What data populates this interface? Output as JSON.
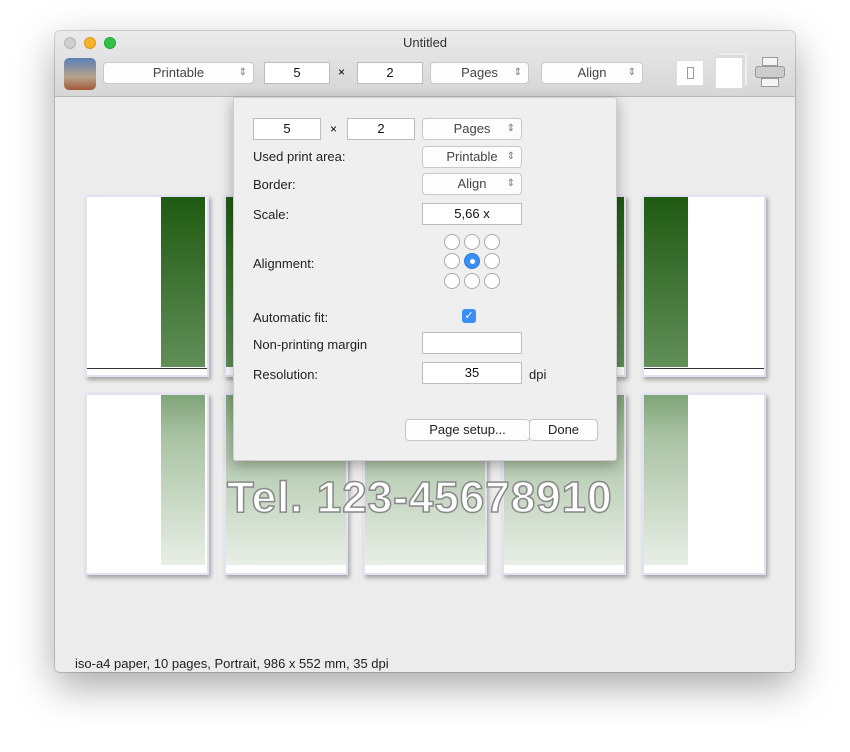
{
  "window": {
    "title": "Untitled"
  },
  "toolbar": {
    "area_select": "Printable",
    "cols": "5",
    "times": "×",
    "rows": "2",
    "unit_select": "Pages",
    "border_select": "Align"
  },
  "poster_text": "Tel. 123-45678910",
  "status": "iso-a4 paper, 10 pages, Portrait, 986 x 552 mm, 35 dpi",
  "panel": {
    "cols": "5",
    "times": "×",
    "rows": "2",
    "unit_select": "Pages",
    "used_print_area_label": "Used print area:",
    "used_print_area": "Printable",
    "border_label": "Border:",
    "border": "Align",
    "scale_label": "Scale:",
    "scale": "5,66 x",
    "alignment_label": "Alignment:",
    "alignment_selected": "center",
    "automatic_fit_label": "Automatic fit:",
    "automatic_fit": true,
    "margin_label": "Non-printing margin",
    "margin": "",
    "resolution_label": "Resolution:",
    "resolution": "35",
    "resolution_unit": "dpi",
    "page_setup": "Page setup...",
    "done": "Done"
  }
}
